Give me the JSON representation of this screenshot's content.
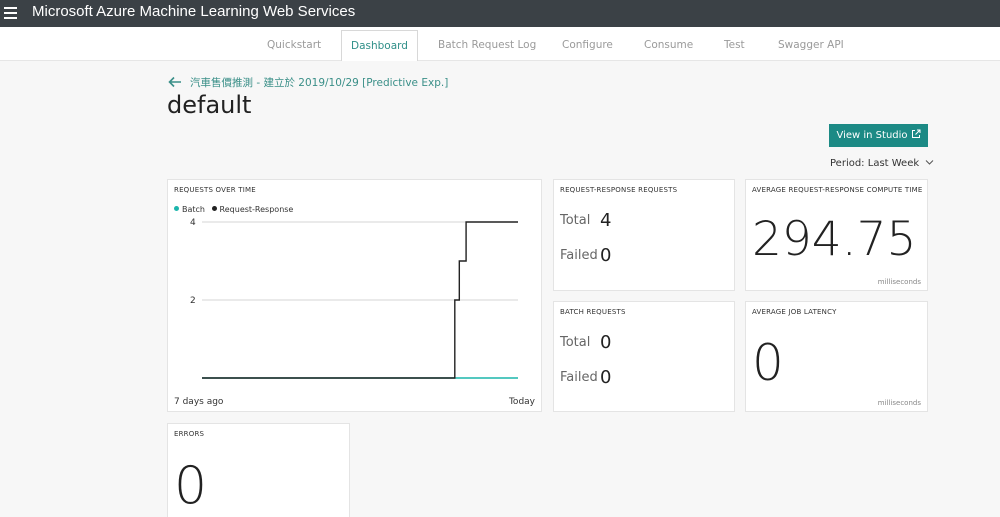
{
  "app": {
    "title": "Microsoft Azure Machine Learning Web Services"
  },
  "tabs": [
    "Quickstart",
    "Dashboard",
    "Batch Request Log",
    "Configure",
    "Consume",
    "Test",
    "Swagger API"
  ],
  "active_tab": "Dashboard",
  "breadcrumb": {
    "link_text": "汽車售價推測 - 建立於 2019/10/29 [Predictive Exp.]"
  },
  "page_title": "default",
  "view_studio_label": "View in Studio",
  "period": {
    "label": "Period:",
    "value": "Last Week"
  },
  "requests_over_time": {
    "title": "REQUESTS OVER TIME",
    "x_start_label": "7 days ago",
    "x_end_label": "Today"
  },
  "chart_data": {
    "type": "line",
    "ylim": [
      0,
      4
    ],
    "yticks": [
      2,
      4
    ],
    "series": [
      {
        "name": "Batch",
        "color": "#1cb5ac",
        "points": [
          [
            0,
            0
          ],
          [
            6.3,
            0
          ],
          [
            7,
            0
          ]
        ]
      },
      {
        "name": "Request-Response",
        "color": "#222222",
        "points": [
          [
            0,
            0
          ],
          [
            5.6,
            0
          ],
          [
            5.6,
            2
          ],
          [
            5.7,
            2
          ],
          [
            5.7,
            3
          ],
          [
            5.85,
            3
          ],
          [
            5.85,
            4
          ],
          [
            7,
            4
          ]
        ]
      }
    ],
    "x_start_label": "7 days ago",
    "x_end_label": "Today",
    "grid": true,
    "legend_position": "top-left"
  },
  "rr_requests": {
    "title": "REQUEST-RESPONSE REQUESTS",
    "total_label": "Total",
    "total_value": "4",
    "failed_label": "Failed",
    "failed_value": "0"
  },
  "batch_requests": {
    "title": "BATCH REQUESTS",
    "total_label": "Total",
    "total_value": "0",
    "failed_label": "Failed",
    "failed_value": "0"
  },
  "avg_compute_time": {
    "title": "AVERAGE REQUEST-RESPONSE COMPUTE TIME",
    "value": "294.75",
    "unit": "milliseconds"
  },
  "avg_job_latency": {
    "title": "AVERAGE JOB LATENCY",
    "value": "0",
    "unit": "milliseconds"
  },
  "errors": {
    "title": "ERRORS",
    "value": "0"
  },
  "colors": {
    "accent": "#1c8a85",
    "topbar": "#3b4146",
    "batch": "#1cb5ac",
    "request_response": "#222222"
  }
}
